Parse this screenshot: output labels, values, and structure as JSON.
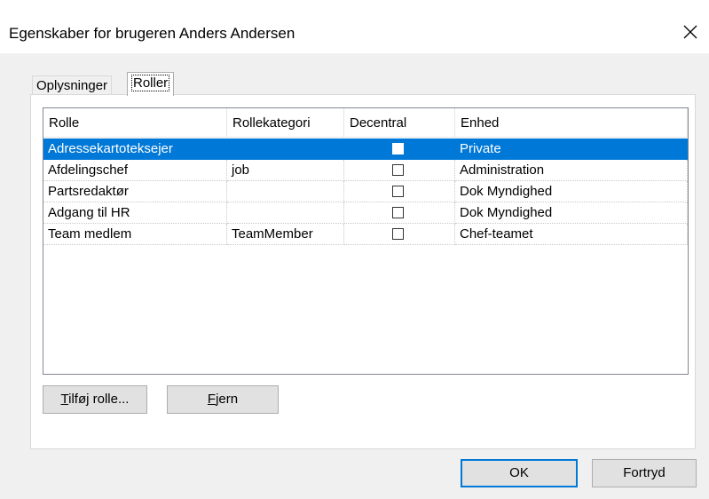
{
  "window": {
    "title": "Egenskaber for brugeren Anders Andersen",
    "close_icon": "close-icon"
  },
  "tabs": [
    {
      "label": "Oplysninger",
      "active": false
    },
    {
      "label": "Roller",
      "active": true
    }
  ],
  "table": {
    "columns": [
      "Rolle",
      "Rollekategori",
      "Decentral",
      "Enhed"
    ],
    "rows": [
      {
        "rolle": "Adressekartoteksejer",
        "kategori": "",
        "decentral": false,
        "enhed": "Private",
        "selected": true
      },
      {
        "rolle": "Afdelingschef",
        "kategori": "job",
        "decentral": false,
        "enhed": "Administration",
        "selected": false
      },
      {
        "rolle": "Partsredaktør",
        "kategori": "",
        "decentral": false,
        "enhed": "Dok Myndighed",
        "selected": false
      },
      {
        "rolle": "Adgang til HR",
        "kategori": "",
        "decentral": false,
        "enhed": "Dok Myndighed",
        "selected": false
      },
      {
        "rolle": "Team medlem",
        "kategori": "TeamMember",
        "decentral": false,
        "enhed": "Chef-teamet",
        "selected": false
      }
    ]
  },
  "buttons": {
    "add_role": {
      "mnemonic": "T",
      "rest": "ilføj rolle..."
    },
    "remove": {
      "mnemonic": "F",
      "rest": "jern"
    },
    "ok": "OK",
    "cancel": "Fortryd"
  },
  "colors": {
    "selection": "#0078d7",
    "dialog_bg": "#f0f0f0"
  }
}
